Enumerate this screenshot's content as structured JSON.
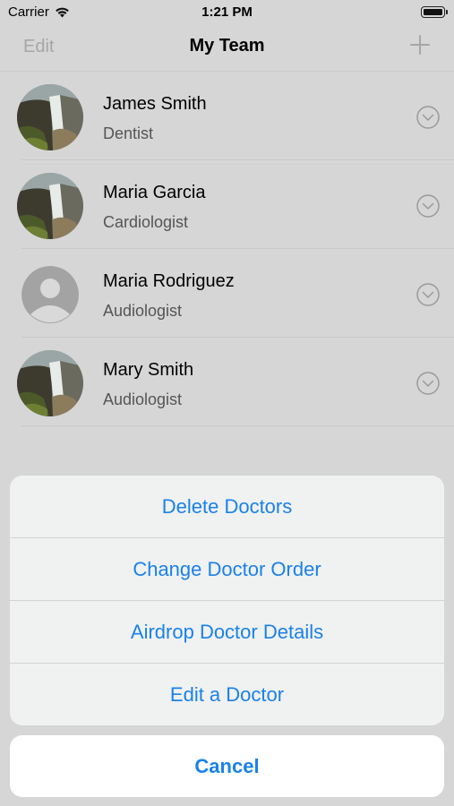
{
  "status_bar": {
    "carrier": "Carrier",
    "time": "1:21 PM"
  },
  "nav": {
    "edit_label": "Edit",
    "title": "My Team"
  },
  "doctors": [
    {
      "name": "James Smith",
      "role": "Dentist",
      "avatar": "waterfall-photo"
    },
    {
      "name": "Maria Garcia",
      "role": "Cardiologist",
      "avatar": "waterfall-photo"
    },
    {
      "name": "Maria Rodriguez",
      "role": "Audiologist",
      "avatar": "person-placeholder"
    },
    {
      "name": "Mary Smith",
      "role": "Audiologist",
      "avatar": "waterfall-photo"
    }
  ],
  "action_sheet": {
    "actions": [
      "Delete Doctors",
      "Change Doctor Order",
      "Airdrop Doctor Details",
      "Edit a Doctor"
    ],
    "cancel_label": "Cancel"
  },
  "colors": {
    "accent": "#1a82e8",
    "dim_background": "#d6d6d6",
    "sheet_background": "#f0f1f1"
  }
}
